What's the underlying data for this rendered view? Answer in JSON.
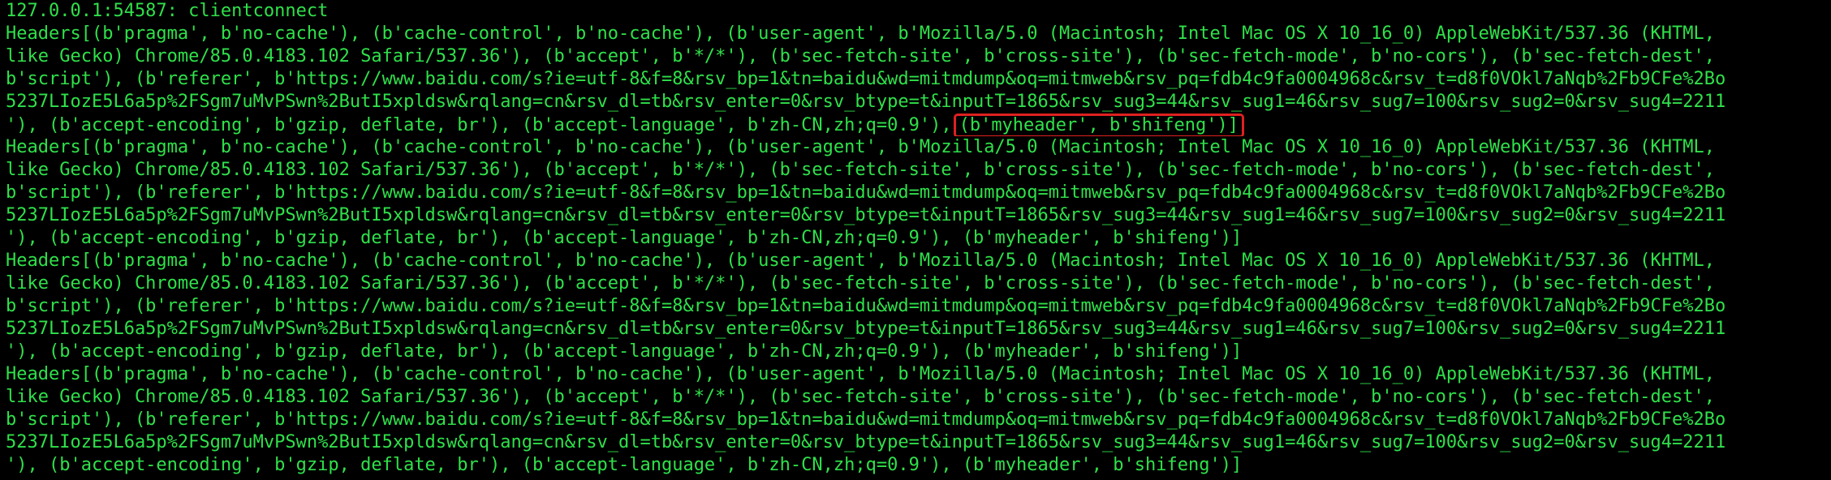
{
  "colors": {
    "background": "#000000",
    "text": "#2fe04a",
    "highlight_border": "#e02020"
  },
  "terminal": {
    "connect_line": "127.0.0.1:54587: clientconnect",
    "blocks": [
      {
        "line1": "Headers[(b'pragma', b'no-cache'), (b'cache-control', b'no-cache'), (b'user-agent', b'Mozilla/5.0 (Macintosh; Intel Mac OS X 10_16_0) AppleWebKit/537.36 (KHTML,",
        "line2": "like Gecko) Chrome/85.0.4183.102 Safari/537.36'), (b'accept', b'*/*'), (b'sec-fetch-site', b'cross-site'), (b'sec-fetch-mode', b'no-cors'), (b'sec-fetch-dest',",
        "line3": "b'script'), (b'referer', b'https://www.baidu.com/s?ie=utf-8&f=8&rsv_bp=1&tn=baidu&wd=mitmdump&oq=mitmweb&rsv_pq=fdb4c9fa0004968c&rsv_t=d8f0VOkl7aNqb%2Fb9CFe%2Bo",
        "line4": "5237LIozE5L6a5p%2FSgm7uMvPSwn%2ButI5xpldsw&rqlang=cn&rsv_dl=tb&rsv_enter=0&rsv_btype=t&inputT=1865&rsv_sug3=44&rsv_sug1=46&rsv_sug7=100&rsv_sug2=0&rsv_sug4=2211",
        "line5_main": "'), (b'accept-encoding', b'gzip, deflate, br'), (b'accept-language', b'zh-CN,zh;q=0.9'),",
        "line5_highlight": "(b'myheader', b'shifeng')]"
      },
      {
        "line1": "Headers[(b'pragma', b'no-cache'), (b'cache-control', b'no-cache'), (b'user-agent', b'Mozilla/5.0 (Macintosh; Intel Mac OS X 10_16_0) AppleWebKit/537.36 (KHTML,",
        "line2": "like Gecko) Chrome/85.0.4183.102 Safari/537.36'), (b'accept', b'*/*'), (b'sec-fetch-site', b'cross-site'), (b'sec-fetch-mode', b'no-cors'), (b'sec-fetch-dest',",
        "line3": "b'script'), (b'referer', b'https://www.baidu.com/s?ie=utf-8&f=8&rsv_bp=1&tn=baidu&wd=mitmdump&oq=mitmweb&rsv_pq=fdb4c9fa0004968c&rsv_t=d8f0VOkl7aNqb%2Fb9CFe%2Bo",
        "line4": "5237LIozE5L6a5p%2FSgm7uMvPSwn%2ButI5xpldsw&rqlang=cn&rsv_dl=tb&rsv_enter=0&rsv_btype=t&inputT=1865&rsv_sug3=44&rsv_sug1=46&rsv_sug7=100&rsv_sug2=0&rsv_sug4=2211",
        "line5": "'), (b'accept-encoding', b'gzip, deflate, br'), (b'accept-language', b'zh-CN,zh;q=0.9'), (b'myheader', b'shifeng')]"
      },
      {
        "line1": "Headers[(b'pragma', b'no-cache'), (b'cache-control', b'no-cache'), (b'user-agent', b'Mozilla/5.0 (Macintosh; Intel Mac OS X 10_16_0) AppleWebKit/537.36 (KHTML,",
        "line2": "like Gecko) Chrome/85.0.4183.102 Safari/537.36'), (b'accept', b'*/*'), (b'sec-fetch-site', b'cross-site'), (b'sec-fetch-mode', b'no-cors'), (b'sec-fetch-dest',",
        "line3": "b'script'), (b'referer', b'https://www.baidu.com/s?ie=utf-8&f=8&rsv_bp=1&tn=baidu&wd=mitmdump&oq=mitmweb&rsv_pq=fdb4c9fa0004968c&rsv_t=d8f0VOkl7aNqb%2Fb9CFe%2Bo",
        "line4": "5237LIozE5L6a5p%2FSgm7uMvPSwn%2ButI5xpldsw&rqlang=cn&rsv_dl=tb&rsv_enter=0&rsv_btype=t&inputT=1865&rsv_sug3=44&rsv_sug1=46&rsv_sug7=100&rsv_sug2=0&rsv_sug4=2211",
        "line5": "'), (b'accept-encoding', b'gzip, deflate, br'), (b'accept-language', b'zh-CN,zh;q=0.9'), (b'myheader', b'shifeng')]"
      },
      {
        "line1": "Headers[(b'pragma', b'no-cache'), (b'cache-control', b'no-cache'), (b'user-agent', b'Mozilla/5.0 (Macintosh; Intel Mac OS X 10_16_0) AppleWebKit/537.36 (KHTML,",
        "line2": "like Gecko) Chrome/85.0.4183.102 Safari/537.36'), (b'accept', b'*/*'), (b'sec-fetch-site', b'cross-site'), (b'sec-fetch-mode', b'no-cors'), (b'sec-fetch-dest',",
        "line3": "b'script'), (b'referer', b'https://www.baidu.com/s?ie=utf-8&f=8&rsv_bp=1&tn=baidu&wd=mitmdump&oq=mitmweb&rsv_pq=fdb4c9fa0004968c&rsv_t=d8f0VOkl7aNqb%2Fb9CFe%2Bo",
        "line4": "5237LIozE5L6a5p%2FSgm7uMvPSwn%2ButI5xpldsw&rqlang=cn&rsv_dl=tb&rsv_enter=0&rsv_btype=t&inputT=1865&rsv_sug3=44&rsv_sug1=46&rsv_sug7=100&rsv_sug2=0&rsv_sug4=2211",
        "line5": "'), (b'accept-encoding', b'gzip, deflate, br'), (b'accept-language', b'zh-CN,zh;q=0.9'), (b'myheader', b'shifeng')]"
      }
    ]
  }
}
